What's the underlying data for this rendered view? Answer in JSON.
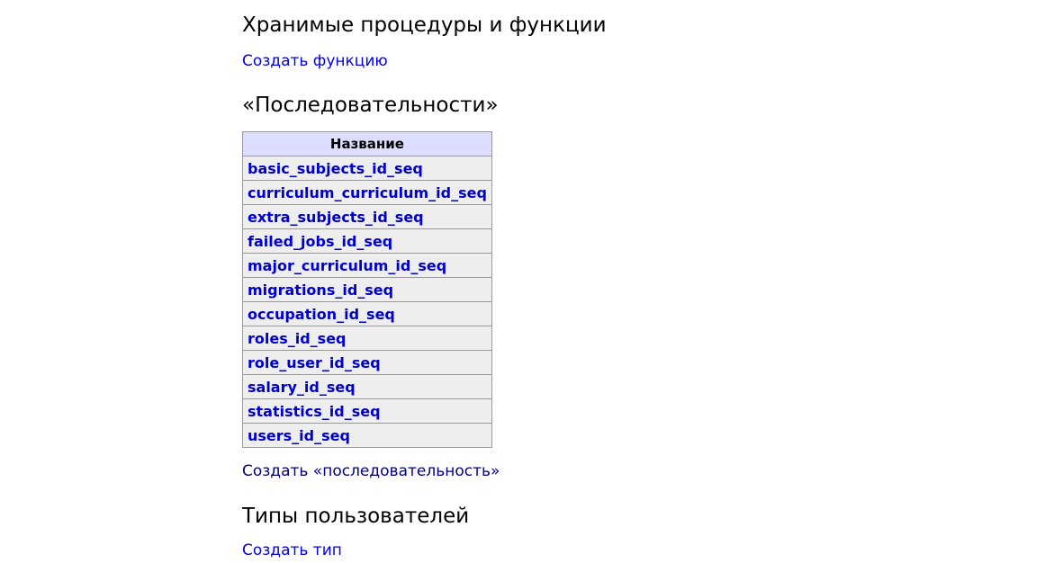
{
  "sections": {
    "functions": {
      "heading": "Хранимые процедуры и функции",
      "create_link": "Создать функцию"
    },
    "sequences": {
      "heading": "«Последовательности»",
      "table": {
        "column_header": "Название",
        "rows": [
          "basic_subjects_id_seq",
          "curriculum_curriculum_id_seq",
          "extra_subjects_id_seq",
          "failed_jobs_id_seq",
          "major_curriculum_id_seq",
          "migrations_id_seq",
          "occupation_id_seq",
          "roles_id_seq",
          "role_user_id_seq",
          "salary_id_seq",
          "statistics_id_seq",
          "users_id_seq"
        ]
      },
      "create_link": "Создать «последовательность»"
    },
    "types": {
      "heading": "Типы пользователей",
      "create_link": "Создать тип"
    }
  },
  "colors": {
    "link": "#0000ee",
    "visited_link": "#000080",
    "table_header_bg": "#ddddff",
    "table_row_bg": "#eeeeee",
    "table_border": "#999999"
  }
}
